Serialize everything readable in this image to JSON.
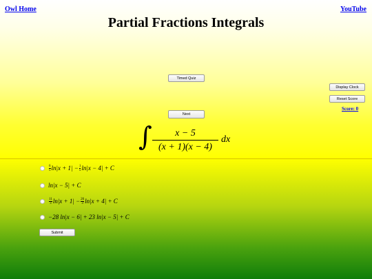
{
  "header": {
    "owl_home": "Owl Home",
    "youtube": "YouTube",
    "title": "Partial Fractions Integrals"
  },
  "buttons": {
    "timed_quiz": "Timed Quiz",
    "display_clock": "Display Clock",
    "reset_score": "Reset Score",
    "next": "Next",
    "submit": "Submit"
  },
  "score": "Score: 0",
  "problem": {
    "numerator": "x − 5",
    "denominator": "(x + 1)(x − 4)",
    "differential": "dx"
  },
  "choices": [
    {
      "parts": [
        "6",
        "5",
        "ln|x + 1| −",
        "1",
        "5",
        "ln|x − 4| + C"
      ]
    },
    {
      "text": "ln|x − 5| + C"
    },
    {
      "parts": [
        "11",
        "3",
        "ln|x + 1| −",
        "26",
        "3",
        "ln|x + 4| + C"
      ]
    },
    {
      "text": "−28 ln|x − 6| + 23 ln|x − 5| + C"
    }
  ]
}
